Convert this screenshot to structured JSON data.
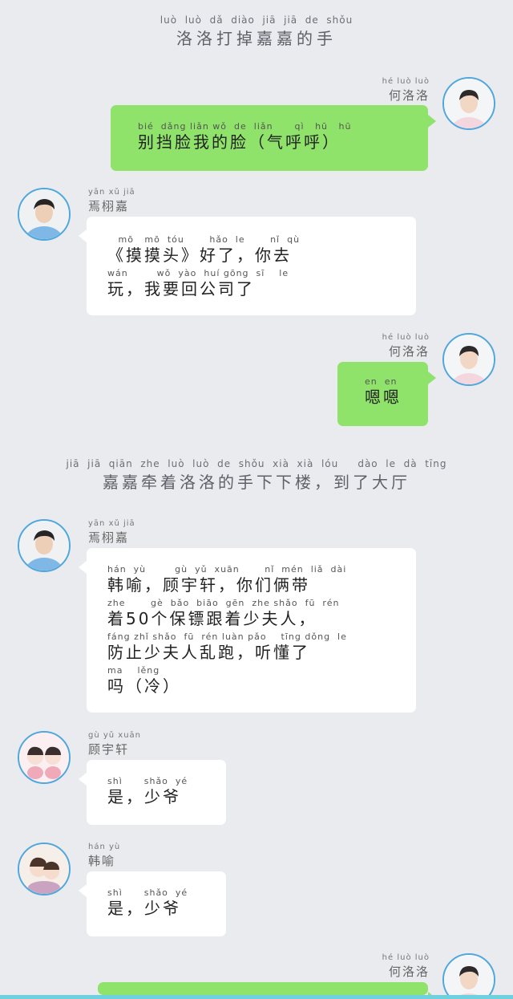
{
  "narration_1": {
    "pinyin": "luò  luò  dǎ  diào  jiā  jiā  de  shǒu",
    "text": "洛洛打掉嘉嘉的手"
  },
  "narration_2": {
    "pinyin": "jiā  jiā  qiān  zhe  luò  luò  de  shǒu  xià  xià  lóu     dào  le  dà  tīng",
    "text": "嘉嘉牵着洛洛的手下下楼，到了大厅"
  },
  "speakers": {
    "he_luoluo": {
      "pinyin": "hé luò luò",
      "name": "何洛洛"
    },
    "yan_xujia": {
      "pinyin": "yān xǔ jiā",
      "name": "焉栩嘉"
    },
    "gu_yuxuan": {
      "pinyin": "gù yǔ xuān",
      "name": "顾宇轩"
    },
    "han_yu": {
      "pinyin": "hán yù",
      "name": "韩喻"
    }
  },
  "messages": {
    "m1": {
      "lines": [
        {
          "pinyin": "bié  dǎng liǎn wǒ  de  liǎn      qì   hū   hū",
          "text": "别挡脸我的脸（气呼呼）"
        }
      ]
    },
    "m2": {
      "lines": [
        {
          "pinyin": "   mō   mō  tóu       hǎo  le       nǐ  qù",
          "text": "《摸摸头》好了，你去"
        },
        {
          "pinyin": "wán        wǒ  yào  huí gōng  sī    le",
          "text": "玩，我要回公司了"
        }
      ]
    },
    "m3": {
      "lines": [
        {
          "pinyin": "en  en",
          "text": "嗯嗯"
        }
      ]
    },
    "m4": {
      "lines": [
        {
          "pinyin": "hán  yù        gù  yǔ  xuān       nǐ  mén  liǎ  dài",
          "text": "韩喻，顾宇轩，你们俩带"
        },
        {
          "pinyin": "zhe       gè  bǎo  biāo  gēn  zhe shǎo  fū  rén",
          "text": "着50个保镖跟着少夫人，"
        },
        {
          "pinyin": "fáng zhǐ shǎo  fū  rén luàn pǎo    tīng dǒng  le",
          "text": "防止少夫人乱跑，听懂了"
        },
        {
          "pinyin": "ma    lěng",
          "text": "吗（冷）"
        }
      ]
    },
    "m5": {
      "lines": [
        {
          "pinyin": "shì      shǎo  yé",
          "text": "是，少爷"
        }
      ]
    },
    "m6": {
      "lines": [
        {
          "pinyin": "shì      shǎo  yé",
          "text": "是，少爷"
        }
      ]
    }
  },
  "colors": {
    "background": "#e9ebee",
    "green_bubble": "#8fe26a",
    "white_bubble": "#ffffff",
    "avatar_ring": "#4fa7dd"
  },
  "icons": {
    "avatar_he": "boy-portrait-icon",
    "avatar_yan": "man-portrait-icon",
    "avatar_gu": "cartoon-couple-icon",
    "avatar_han": "cartoon-couple-icon"
  }
}
